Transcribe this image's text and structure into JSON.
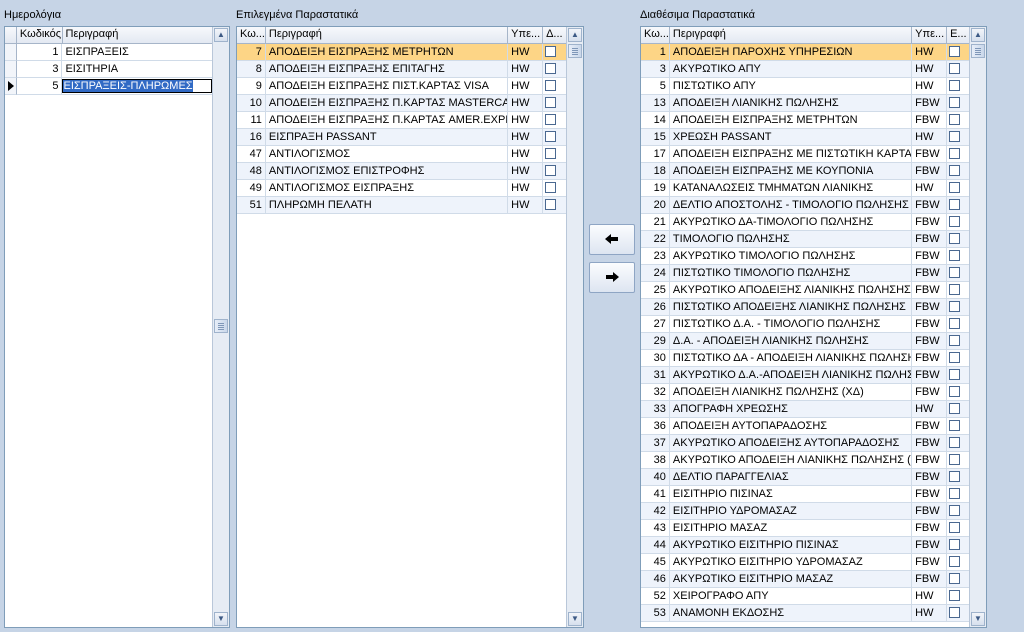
{
  "calendars": {
    "title": "Ημερολόγια",
    "columns": [
      "Κωδικός",
      "Περιγραφή"
    ],
    "rows": [
      {
        "code": "1",
        "desc": "ΕΙΣΠΡΑΞΕΙΣ"
      },
      {
        "code": "3",
        "desc": "ΕΙΣΙΤΗΡΙΑ"
      },
      {
        "code": "5",
        "desc": "ΕΙΣΠΡΑΞΕΙΣ-ΠΛΗΡΩΜΕΣ"
      }
    ]
  },
  "selected_docs": {
    "title": "Επιλεγμένα Παραστατικά",
    "columns": [
      "Κω...",
      "Περιγραφή",
      "Υπε...",
      "Δ..."
    ],
    "rows": [
      {
        "code": "7",
        "desc": "ΑΠΟΔΕΙΞΗ ΕΙΣΠΡΑΞΗΣ ΜΕΤΡΗΤΩΝ",
        "type": "HW"
      },
      {
        "code": "8",
        "desc": "ΑΠΟΔΕΙΞΗ ΕΙΣΠΡΑΞΗΣ ΕΠΙΤΑΓΗΣ",
        "type": "HW"
      },
      {
        "code": "9",
        "desc": "ΑΠΟΔΕΙΞΗ ΕΙΣΠΡΑΞΗΣ ΠΙΣΤ.ΚΑΡΤΑΣ VISA",
        "type": "HW"
      },
      {
        "code": "10",
        "desc": "ΑΠΟΔΕΙΞΗ ΕΙΣΠΡΑΞΗΣ Π.ΚΑΡΤΑΣ MASTERCARD",
        "type": "HW"
      },
      {
        "code": "11",
        "desc": "ΑΠΟΔΕΙΞΗ ΕΙΣΠΡΑΞΗΣ Π.ΚΑΡΤΑΣ AMER.EXPRESS",
        "type": "HW"
      },
      {
        "code": "16",
        "desc": "ΕΙΣΠΡΑΞΗ PASSANT",
        "type": "HW"
      },
      {
        "code": "47",
        "desc": "ΑΝΤΙΛΟΓΙΣΜΟΣ",
        "type": "HW"
      },
      {
        "code": "48",
        "desc": "ΑΝΤΙΛΟΓΙΣΜΟΣ ΕΠΙΣΤΡΟΦΗΣ",
        "type": "HW"
      },
      {
        "code": "49",
        "desc": "ΑΝΤΙΛΟΓΙΣΜΟΣ ΕΙΣΠΡΑΞΗΣ",
        "type": "HW"
      },
      {
        "code": "51",
        "desc": "ΠΛΗΡΩΜΗ ΠΕΛΑΤΗ",
        "type": "HW"
      }
    ]
  },
  "available_docs": {
    "title": "Διαθέσιμα Παραστατικά",
    "columns": [
      "Κω...",
      "Περιγραφή",
      "Υπε...",
      "Ε..."
    ],
    "rows": [
      {
        "code": "1",
        "desc": "ΑΠΟΔΕΙΞΗ ΠΑΡΟΧΗΣ ΥΠΗΡΕΣΙΩΝ",
        "type": "HW"
      },
      {
        "code": "3",
        "desc": "ΑΚΥΡΩΤΙΚΟ ΑΠΥ",
        "type": "HW"
      },
      {
        "code": "5",
        "desc": "ΠΙΣΤΩΤΙΚΟ ΑΠΥ",
        "type": "HW"
      },
      {
        "code": "13",
        "desc": "ΑΠΟΔΕΙΞΗ ΛΙΑΝΙΚΗΣ ΠΩΛΗΣΗΣ",
        "type": "FBW"
      },
      {
        "code": "14",
        "desc": "ΑΠΟΔΕΙΞΗ ΕΙΣΠΡΑΞΗΣ ΜΕΤΡΗΤΩΝ",
        "type": "FBW"
      },
      {
        "code": "15",
        "desc": "ΧΡΕΩΣΗ PASSANT",
        "type": "HW"
      },
      {
        "code": "17",
        "desc": "ΑΠΟΔΕΙΞΗ ΕΙΣΠΡΑΞΗΣ ΜΕ ΠΙΣΤΩΤΙΚΗ ΚΑΡΤΑ",
        "type": "FBW"
      },
      {
        "code": "18",
        "desc": "ΑΠΟΔΕΙΞΗ ΕΙΣΠΡΑΞΗΣ ΜΕ ΚΟΥΠΟΝΙΑ",
        "type": "FBW"
      },
      {
        "code": "19",
        "desc": "ΚΑΤΑΝΑΛΩΣΕΙΣ ΤΜΗΜΑΤΩΝ ΛΙΑΝΙΚΗΣ",
        "type": "HW"
      },
      {
        "code": "20",
        "desc": "ΔΕΛΤΙΟ ΑΠΟΣΤΟΛΗΣ - ΤΙΜΟΛΟΓΙΟ ΠΩΛΗΣΗΣ",
        "type": "FBW"
      },
      {
        "code": "21",
        "desc": "ΑΚΥΡΩΤΙΚΟ ΔΑ-ΤΙΜΟΛΟΓΙΟ ΠΩΛΗΣΗΣ",
        "type": "FBW"
      },
      {
        "code": "22",
        "desc": "ΤΙΜΟΛΟΓΙΟ ΠΩΛΗΣΗΣ",
        "type": "FBW"
      },
      {
        "code": "23",
        "desc": "ΑΚΥΡΩΤΙΚΟ ΤΙΜΟΛΟΓΙΟ ΠΩΛΗΣΗΣ",
        "type": "FBW"
      },
      {
        "code": "24",
        "desc": "ΠΙΣΤΩΤΙΚΟ ΤΙΜΟΛΟΓΙΟ ΠΩΛΗΣΗΣ",
        "type": "FBW"
      },
      {
        "code": "25",
        "desc": "ΑΚΥΡΩΤΙΚΟ ΑΠΟΔΕΙΞΗΣ ΛΙΑΝΙΚΗΣ ΠΩΛΗΣΗΣ",
        "type": "FBW"
      },
      {
        "code": "26",
        "desc": "ΠΙΣΤΩΤΙΚΟ ΑΠΟΔΕΙΞΗΣ ΛΙΑΝΙΚΗΣ ΠΩΛΗΣΗΣ",
        "type": "FBW"
      },
      {
        "code": "27",
        "desc": "ΠΙΣΤΩΤΙΚΟ Δ.Α. - ΤΙΜΟΛΟΓΙΟ ΠΩΛΗΣΗΣ",
        "type": "FBW"
      },
      {
        "code": "29",
        "desc": "Δ.Α. - ΑΠΟΔΕΙΞΗ ΛΙΑΝΙΚΗΣ ΠΩΛΗΣΗΣ",
        "type": "FBW"
      },
      {
        "code": "30",
        "desc": "ΠΙΣΤΩΤΙΚΟ ΔΑ - ΑΠΟΔΕΙΞΗ ΛΙΑΝΙΚΗΣ ΠΩΛΗΣΗΣ",
        "type": "FBW"
      },
      {
        "code": "31",
        "desc": "ΑΚΥΡΩΤΙΚΟ Δ.Α.-ΑΠΟΔΕΙΞΗ ΛΙΑΝΙΚΗΣ ΠΩΛΗΣΗΣ",
        "type": "FBW"
      },
      {
        "code": "32",
        "desc": "ΑΠΟΔΕΙΞΗ ΛΙΑΝΙΚΗΣ ΠΩΛΗΣΗΣ (ΧΔ)",
        "type": "FBW"
      },
      {
        "code": "33",
        "desc": "ΑΠΟΓΡΑΦΗ ΧΡΕΩΣΗΣ",
        "type": "HW"
      },
      {
        "code": "36",
        "desc": "ΑΠΟΔΕΙΞΗ ΑΥΤΟΠΑΡΑΔΟΣΗΣ",
        "type": "FBW"
      },
      {
        "code": "37",
        "desc": "ΑΚΥΡΩΤΙΚΟ ΑΠΟΔΕΙΞΗΣ ΑΥΤΟΠΑΡΑΔΟΣΗΣ",
        "type": "FBW"
      },
      {
        "code": "38",
        "desc": "ΑΚΥΡΩΤΙΚΟ ΑΠΟΔΕΙΞΗ ΛΙΑΝΙΚΗΣ ΠΩΛΗΣΗΣ (ΧΔ)",
        "type": "FBW"
      },
      {
        "code": "40",
        "desc": "ΔΕΛΤΙΟ ΠΑΡΑΓΓΕΛΙΑΣ",
        "type": "FBW"
      },
      {
        "code": "41",
        "desc": "ΕΙΣΙΤΗΡΙΟ ΠΙΣΙΝΑΣ",
        "type": "FBW"
      },
      {
        "code": "42",
        "desc": "ΕΙΣΙΤΗΡΙΟ ΥΔΡΟΜΑΣΑΖ",
        "type": "FBW"
      },
      {
        "code": "43",
        "desc": "ΕΙΣΙΤΗΡΙΟ ΜΑΣΑΖ",
        "type": "FBW"
      },
      {
        "code": "44",
        "desc": "ΑΚΥΡΩΤΙΚΟ ΕΙΣΙΤΗΡΙΟ ΠΙΣΙΝΑΣ",
        "type": "FBW"
      },
      {
        "code": "45",
        "desc": "ΑΚΥΡΩΤΙΚΟ ΕΙΣΙΤΗΡΙΟ ΥΔΡΟΜΑΣΑΖ",
        "type": "FBW"
      },
      {
        "code": "46",
        "desc": "ΑΚΥΡΩΤΙΚΟ ΕΙΣΙΤΗΡΙΟ ΜΑΣΑΖ",
        "type": "FBW"
      },
      {
        "code": "52",
        "desc": "ΧΕΙΡΟΓΡΑΦΟ ΑΠΥ",
        "type": "HW"
      },
      {
        "code": "53",
        "desc": "ΑΝΑΜΟΝΗ ΕΚΔΟΣΗΣ",
        "type": "HW"
      }
    ]
  },
  "buttons": {
    "remove_label": "🡄",
    "add_label": "🡆"
  },
  "colors": {
    "background": "#c6d4e6",
    "selected_row": "#fdd586",
    "alt_row": "#eef3fb",
    "edit_highlight": "#316ac5"
  },
  "icons": {
    "scroll_up": "chevron-up-icon",
    "scroll_down": "chevron-down-icon",
    "row_pointer": "row-pointer-icon",
    "left_arrow": "arrow-left-icon",
    "right_arrow": "arrow-right-icon"
  }
}
